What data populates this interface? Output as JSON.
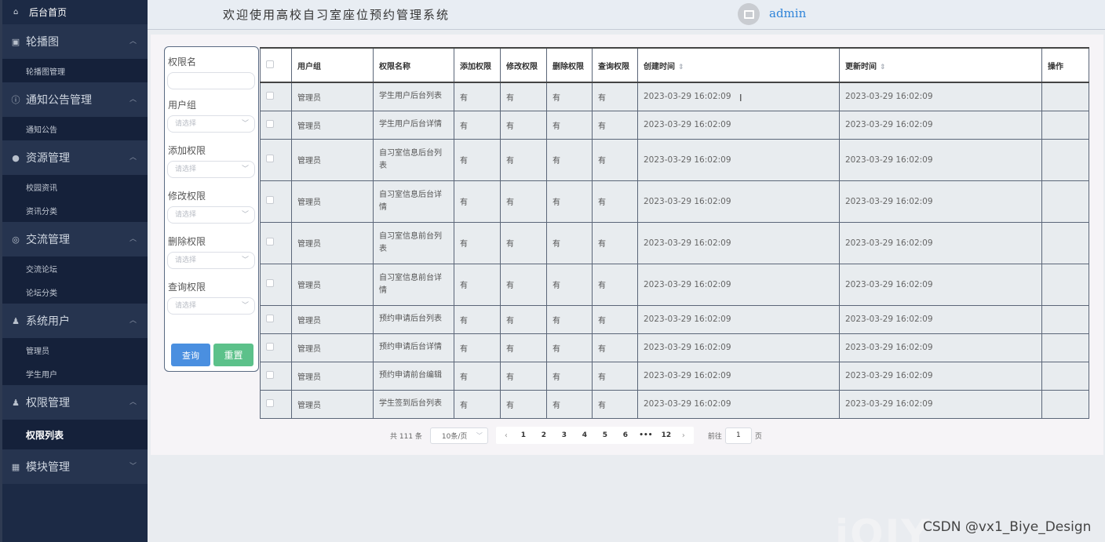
{
  "header": {
    "title": "欢迎使用高校自习室座位预约管理系统",
    "username": "admin"
  },
  "sidebar": {
    "home": "后台首页",
    "groups": [
      {
        "label": "轮播图",
        "icon": "image-icon",
        "items": [
          "轮播图管理"
        ]
      },
      {
        "label": "通知公告管理",
        "icon": "info-circle-icon",
        "items": [
          "通知公告"
        ]
      },
      {
        "label": "资源管理",
        "icon": "location-pin-icon",
        "items": [
          "校园资讯",
          "资讯分类"
        ]
      },
      {
        "label": "交流管理",
        "icon": "chat-icon",
        "items": [
          "交流论坛",
          "论坛分类"
        ]
      },
      {
        "label": "系统用户",
        "icon": "user-icon",
        "items": [
          "管理员",
          "学生用户"
        ]
      },
      {
        "label": "权限管理",
        "icon": "user-icon",
        "items": [
          "权限列表"
        ]
      },
      {
        "label": "模块管理",
        "icon": "grid-icon",
        "items": []
      }
    ],
    "active_item": "权限列表"
  },
  "filter": {
    "labels": [
      "权限名",
      "用户组",
      "添加权限",
      "修改权限",
      "删除权限",
      "查询权限"
    ],
    "select_placeholder": "请选择",
    "query_button": "查询",
    "reset_button": "重置"
  },
  "table": {
    "headers": [
      "用户组",
      "权限名称",
      "添加权限",
      "修改权限",
      "删除权限",
      "查询权限",
      "创建时间",
      "更新时间",
      "操作"
    ],
    "rows": [
      {
        "group": "管理员",
        "name": "学生用户后台列表",
        "add": "有",
        "edit": "有",
        "del": "有",
        "query": "有",
        "created": "2023-03-29 16:02:09",
        "updated": "2023-03-29 16:02:09"
      },
      {
        "group": "管理员",
        "name": "学生用户后台详情",
        "add": "有",
        "edit": "有",
        "del": "有",
        "query": "有",
        "created": "2023-03-29 16:02:09",
        "updated": "2023-03-29 16:02:09"
      },
      {
        "group": "管理员",
        "name": "自习室信息后台列表",
        "add": "有",
        "edit": "有",
        "del": "有",
        "query": "有",
        "created": "2023-03-29 16:02:09",
        "updated": "2023-03-29 16:02:09"
      },
      {
        "group": "管理员",
        "name": "自习室信息后台详情",
        "add": "有",
        "edit": "有",
        "del": "有",
        "query": "有",
        "created": "2023-03-29 16:02:09",
        "updated": "2023-03-29 16:02:09"
      },
      {
        "group": "管理员",
        "name": "自习室信息前台列表",
        "add": "有",
        "edit": "有",
        "del": "有",
        "query": "有",
        "created": "2023-03-29 16:02:09",
        "updated": "2023-03-29 16:02:09"
      },
      {
        "group": "管理员",
        "name": "自习室信息前台详情",
        "add": "有",
        "edit": "有",
        "del": "有",
        "query": "有",
        "created": "2023-03-29 16:02:09",
        "updated": "2023-03-29 16:02:09"
      },
      {
        "group": "管理员",
        "name": "预约申请后台列表",
        "add": "有",
        "edit": "有",
        "del": "有",
        "query": "有",
        "created": "2023-03-29 16:02:09",
        "updated": "2023-03-29 16:02:09"
      },
      {
        "group": "管理员",
        "name": "预约申请后台详情",
        "add": "有",
        "edit": "有",
        "del": "有",
        "query": "有",
        "created": "2023-03-29 16:02:09",
        "updated": "2023-03-29 16:02:09"
      },
      {
        "group": "管理员",
        "name": "预约申请前台编辑",
        "add": "有",
        "edit": "有",
        "del": "有",
        "query": "有",
        "created": "2023-03-29 16:02:09",
        "updated": "2023-03-29 16:02:09"
      },
      {
        "group": "管理员",
        "name": "学生签到后台列表",
        "add": "有",
        "edit": "有",
        "del": "有",
        "query": "有",
        "created": "2023-03-29 16:02:09",
        "updated": "2023-03-29 16:02:09"
      }
    ]
  },
  "pagination": {
    "total": "共 111 条",
    "page_size": "10条/页",
    "pages": [
      "1",
      "2",
      "3",
      "4",
      "5",
      "6",
      "•••",
      "12"
    ],
    "goto_label": "前往",
    "goto_value": "1",
    "page_unit": "页"
  },
  "watermark": {
    "text": "CSDN @vx1_Biye_Design"
  }
}
